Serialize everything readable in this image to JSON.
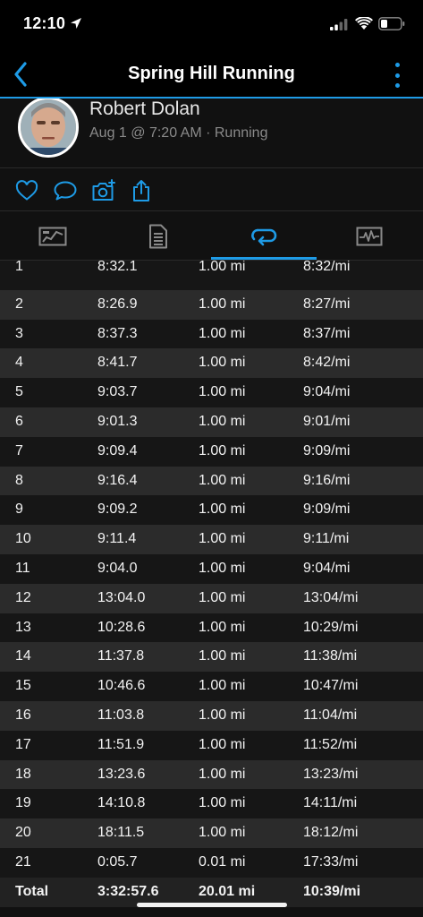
{
  "status_bar": {
    "time": "12:10"
  },
  "nav": {
    "title": "Spring Hill Running"
  },
  "profile": {
    "name": "Robert Dolan",
    "meta": "Aug 1 @ 7:20 AM · Running"
  },
  "tabs": [
    {
      "name": "summary",
      "active": false
    },
    {
      "name": "details",
      "active": false
    },
    {
      "name": "laps",
      "active": true
    },
    {
      "name": "charts",
      "active": false
    }
  ],
  "laps": [
    {
      "lap": "1",
      "time": "8:32.1",
      "distance": "1.00 mi",
      "pace": "8:32/mi"
    },
    {
      "lap": "2",
      "time": "8:26.9",
      "distance": "1.00 mi",
      "pace": "8:27/mi"
    },
    {
      "lap": "3",
      "time": "8:37.3",
      "distance": "1.00 mi",
      "pace": "8:37/mi"
    },
    {
      "lap": "4",
      "time": "8:41.7",
      "distance": "1.00 mi",
      "pace": "8:42/mi"
    },
    {
      "lap": "5",
      "time": "9:03.7",
      "distance": "1.00 mi",
      "pace": "9:04/mi"
    },
    {
      "lap": "6",
      "time": "9:01.3",
      "distance": "1.00 mi",
      "pace": "9:01/mi"
    },
    {
      "lap": "7",
      "time": "9:09.4",
      "distance": "1.00 mi",
      "pace": "9:09/mi"
    },
    {
      "lap": "8",
      "time": "9:16.4",
      "distance": "1.00 mi",
      "pace": "9:16/mi"
    },
    {
      "lap": "9",
      "time": "9:09.2",
      "distance": "1.00 mi",
      "pace": "9:09/mi"
    },
    {
      "lap": "10",
      "time": "9:11.4",
      "distance": "1.00 mi",
      "pace": "9:11/mi"
    },
    {
      "lap": "11",
      "time": "9:04.0",
      "distance": "1.00 mi",
      "pace": "9:04/mi"
    },
    {
      "lap": "12",
      "time": "13:04.0",
      "distance": "1.00 mi",
      "pace": "13:04/mi"
    },
    {
      "lap": "13",
      "time": "10:28.6",
      "distance": "1.00 mi",
      "pace": "10:29/mi"
    },
    {
      "lap": "14",
      "time": "11:37.8",
      "distance": "1.00 mi",
      "pace": "11:38/mi"
    },
    {
      "lap": "15",
      "time": "10:46.6",
      "distance": "1.00 mi",
      "pace": "10:47/mi"
    },
    {
      "lap": "16",
      "time": "11:03.8",
      "distance": "1.00 mi",
      "pace": "11:04/mi"
    },
    {
      "lap": "17",
      "time": "11:51.9",
      "distance": "1.00 mi",
      "pace": "11:52/mi"
    },
    {
      "lap": "18",
      "time": "13:23.6",
      "distance": "1.00 mi",
      "pace": "13:23/mi"
    },
    {
      "lap": "19",
      "time": "14:10.8",
      "distance": "1.00 mi",
      "pace": "14:11/mi"
    },
    {
      "lap": "20",
      "time": "18:11.5",
      "distance": "1.00 mi",
      "pace": "18:12/mi"
    },
    {
      "lap": "21",
      "time": "0:05.7",
      "distance": "0.01 mi",
      "pace": "17:33/mi"
    }
  ],
  "total": {
    "label": "Total",
    "time": "3:32:57.6",
    "distance": "20.01 mi",
    "pace": "10:39/mi"
  },
  "colors": {
    "accent": "#1e9be6",
    "background": "#111111",
    "row_alt": "#2b2b2b"
  }
}
